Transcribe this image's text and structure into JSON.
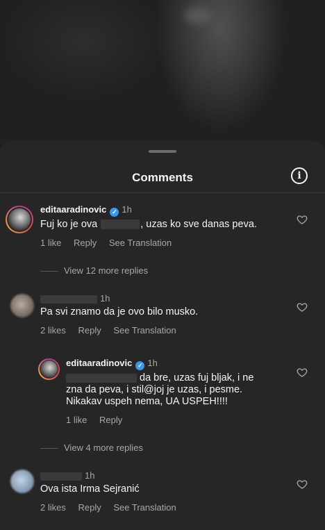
{
  "sheet": {
    "title": "Comments"
  },
  "comments": [
    {
      "username": "editaaradinovic",
      "time": "1h",
      "text_before": "Fuj ko je ova",
      "text_after": ", uzas ko sve danas peva.",
      "likes": "1 like",
      "reply": "Reply",
      "translation": "See Translation"
    },
    {
      "time": "1h",
      "text": "Pa svi znamo da je ovo bilo musko.",
      "likes": "2 likes",
      "reply": "Reply",
      "translation": "See Translation"
    },
    {
      "time": "1h",
      "text": "Ova ista Irma Sejranić",
      "likes": "2 likes",
      "reply": "Reply",
      "translation": "See Translation"
    }
  ],
  "reply": {
    "username": "editaaradinovic",
    "time": "1h",
    "line1": "da bre, uzas fuj bljak, i ne",
    "line2": "zna da peva, i stil@joj je uzas, i pesme.",
    "line3": "Nikakav uspeh nema, UA USPEH!!!!",
    "likes": "1 like",
    "reply": "Reply"
  },
  "view_replies": [
    "View 12 more replies",
    "View 4 more replies"
  ],
  "icons": [
    "info-icon",
    "heart-icon",
    "verified-badge-icon"
  ],
  "colors": {
    "sheet_bg": "#262627",
    "muted": "#a8a8a8",
    "verified": "#3897f0"
  }
}
